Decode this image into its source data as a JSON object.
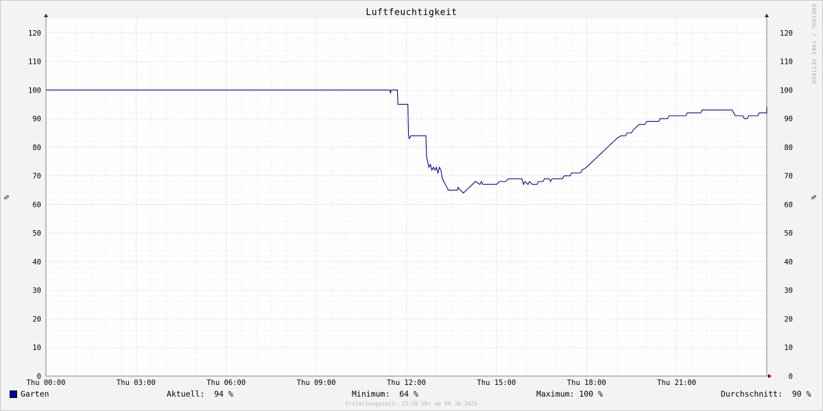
{
  "chart_data": {
    "type": "line",
    "title": "Luftfeuchtigkeit",
    "ylabel": "%",
    "ylim": [
      0,
      125
    ],
    "y_ticks": [
      0,
      10,
      20,
      30,
      40,
      50,
      60,
      70,
      80,
      90,
      100,
      110,
      120
    ],
    "xlim_hours": [
      0,
      24
    ],
    "x_ticks": [
      {
        "h": 0,
        "label": "Thu 00:00"
      },
      {
        "h": 3,
        "label": "Thu 03:00"
      },
      {
        "h": 6,
        "label": "Thu 06:00"
      },
      {
        "h": 9,
        "label": "Thu 09:00"
      },
      {
        "h": 12,
        "label": "Thu 12:00"
      },
      {
        "h": 15,
        "label": "Thu 15:00"
      },
      {
        "h": 18,
        "label": "Thu 18:00"
      },
      {
        "h": 21,
        "label": "Thu 21:00"
      }
    ],
    "grid": true,
    "series": [
      {
        "name": "Garten",
        "color": "#000099",
        "points": [
          [
            0,
            100
          ],
          [
            11.45,
            100
          ],
          [
            11.47,
            99
          ],
          [
            11.5,
            100
          ],
          [
            11.7,
            100
          ],
          [
            11.72,
            95
          ],
          [
            12.05,
            95
          ],
          [
            12.07,
            84
          ],
          [
            12.1,
            83
          ],
          [
            12.15,
            84
          ],
          [
            12.65,
            84
          ],
          [
            12.67,
            77
          ],
          [
            12.75,
            73
          ],
          [
            12.8,
            74
          ],
          [
            12.85,
            72
          ],
          [
            12.9,
            73
          ],
          [
            12.95,
            72
          ],
          [
            13.0,
            73
          ],
          [
            13.05,
            71
          ],
          [
            13.1,
            73
          ],
          [
            13.15,
            72
          ],
          [
            13.2,
            69
          ],
          [
            13.25,
            68
          ],
          [
            13.3,
            67
          ],
          [
            13.35,
            66
          ],
          [
            13.4,
            65
          ],
          [
            13.7,
            65
          ],
          [
            13.72,
            66
          ],
          [
            13.8,
            65
          ],
          [
            13.9,
            64
          ],
          [
            14.0,
            65
          ],
          [
            14.1,
            66
          ],
          [
            14.2,
            67
          ],
          [
            14.3,
            68
          ],
          [
            14.45,
            67
          ],
          [
            14.5,
            68
          ],
          [
            14.55,
            67
          ],
          [
            15.0,
            67
          ],
          [
            15.1,
            68
          ],
          [
            15.3,
            68
          ],
          [
            15.4,
            69
          ],
          [
            15.85,
            69
          ],
          [
            15.9,
            67
          ],
          [
            15.95,
            68
          ],
          [
            16.05,
            67
          ],
          [
            16.1,
            68
          ],
          [
            16.2,
            67
          ],
          [
            16.35,
            67
          ],
          [
            16.4,
            68
          ],
          [
            16.55,
            68
          ],
          [
            16.6,
            69
          ],
          [
            16.75,
            69
          ],
          [
            16.8,
            68
          ],
          [
            16.85,
            69
          ],
          [
            17.2,
            69
          ],
          [
            17.25,
            70
          ],
          [
            17.45,
            70
          ],
          [
            17.5,
            71
          ],
          [
            17.8,
            71
          ],
          [
            17.85,
            72
          ],
          [
            18.0,
            73
          ],
          [
            18.1,
            74
          ],
          [
            18.2,
            75
          ],
          [
            18.3,
            76
          ],
          [
            18.4,
            77
          ],
          [
            18.5,
            78
          ],
          [
            18.6,
            79
          ],
          [
            18.7,
            80
          ],
          [
            18.8,
            81
          ],
          [
            18.9,
            82
          ],
          [
            19.0,
            83
          ],
          [
            19.15,
            84
          ],
          [
            19.3,
            84
          ],
          [
            19.35,
            85
          ],
          [
            19.5,
            85
          ],
          [
            19.55,
            86
          ],
          [
            19.65,
            87
          ],
          [
            19.75,
            88
          ],
          [
            19.95,
            88
          ],
          [
            20.0,
            89
          ],
          [
            20.4,
            89
          ],
          [
            20.45,
            90
          ],
          [
            20.7,
            90
          ],
          [
            20.75,
            91
          ],
          [
            21.3,
            91
          ],
          [
            21.35,
            92
          ],
          [
            21.8,
            92
          ],
          [
            21.85,
            93
          ],
          [
            22.85,
            93
          ],
          [
            22.9,
            92
          ],
          [
            22.95,
            91
          ],
          [
            23.2,
            91
          ],
          [
            23.25,
            90
          ],
          [
            23.35,
            90
          ],
          [
            23.4,
            91
          ],
          [
            23.7,
            91
          ],
          [
            23.75,
            92
          ],
          [
            24.05,
            92
          ],
          [
            24.1,
            93
          ],
          [
            24.35,
            93
          ],
          [
            24.4,
            94
          ],
          [
            24.5,
            94
          ]
        ]
      }
    ]
  },
  "side_label": "RRDTOOL / TOBI OETIKER",
  "legend": {
    "series_name": "Garten",
    "current_label": "Aktuell:",
    "current_value": "94 %",
    "min_label": "Minimum:",
    "min_value": "64 %",
    "max_label": "Maximum:",
    "max_value": "100 %",
    "avg_label": "Durchschnitt:",
    "avg_value": "90 %"
  },
  "creation_info": "Erstellungszeit: 23:58 Uhr am 09.10.2025"
}
